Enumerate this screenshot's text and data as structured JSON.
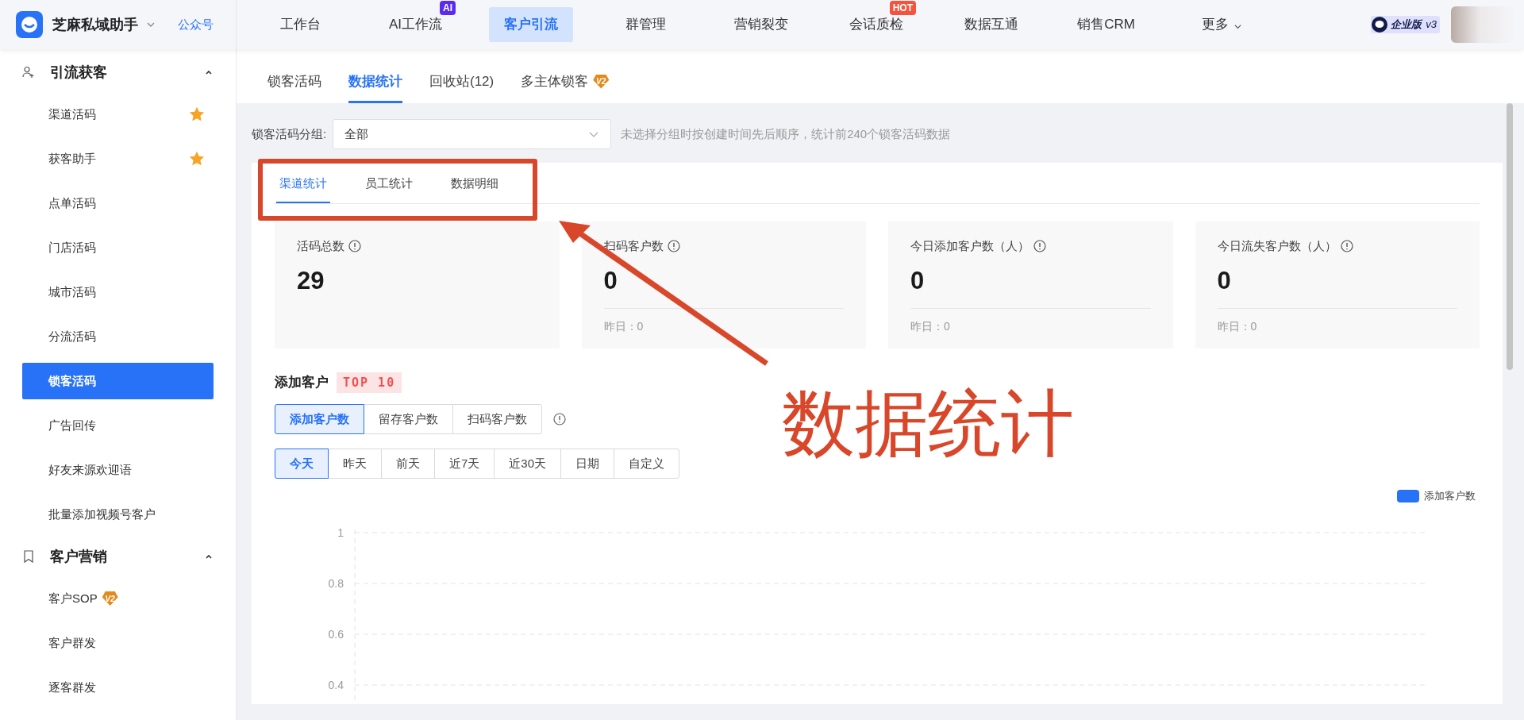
{
  "app": {
    "name": "芝麻私域助手",
    "link": "公众号"
  },
  "nav": [
    {
      "label": "工作台",
      "selected": false
    },
    {
      "label": "AI工作流",
      "selected": false,
      "badge": {
        "text": "AI",
        "color": "#5b2bf0"
      }
    },
    {
      "label": "客户引流",
      "selected": true
    },
    {
      "label": "群管理",
      "selected": false
    },
    {
      "label": "营销裂变",
      "selected": false
    },
    {
      "label": "会话质检",
      "selected": false,
      "badge": {
        "text": "HOT",
        "color": "#f5533d"
      }
    },
    {
      "label": "数据互通",
      "selected": false
    },
    {
      "label": "销售CRM",
      "selected": false
    },
    {
      "label": "更多",
      "selected": false,
      "dropdown": true
    }
  ],
  "account": {
    "edition": "企业版",
    "version": "v3"
  },
  "sidebar": {
    "sections": [
      {
        "title": "引流获客",
        "expanded": true,
        "items": [
          {
            "label": "渠道活码",
            "starred": true,
            "selected": false
          },
          {
            "label": "获客助手",
            "starred": true,
            "selected": false
          },
          {
            "label": "点单活码",
            "starred": false,
            "selected": false
          },
          {
            "label": "门店活码",
            "starred": false,
            "selected": false
          },
          {
            "label": "城市活码",
            "starred": false,
            "selected": false
          },
          {
            "label": "分流活码",
            "starred": false,
            "selected": false
          },
          {
            "label": "锁客活码",
            "starred": false,
            "selected": true
          },
          {
            "label": "广告回传",
            "starred": false,
            "selected": false
          },
          {
            "label": "好友来源欢迎语",
            "starred": false,
            "selected": false
          },
          {
            "label": "批量添加视频号客户",
            "starred": false,
            "selected": false
          }
        ]
      },
      {
        "title": "客户营销",
        "expanded": true,
        "items": [
          {
            "label": "客户SOP",
            "starred": false,
            "selected": false,
            "badge": "V2"
          },
          {
            "label": "客户群发",
            "starred": false,
            "selected": false
          },
          {
            "label": "逐客群发",
            "starred": false,
            "selected": false
          }
        ]
      }
    ]
  },
  "subtabs": [
    {
      "label": "锁客活码",
      "selected": false
    },
    {
      "label": "数据统计",
      "selected": true
    },
    {
      "label": "回收站(12)",
      "selected": false
    },
    {
      "label": "多主体锁客",
      "selected": false,
      "badge": "V2"
    }
  ],
  "filter": {
    "label": "锁客活码分组:",
    "value": "全部",
    "hint": "未选择分组时按创建时间先后顺序，统计前240个锁客活码数据"
  },
  "inner_tabs": [
    {
      "label": "渠道统计",
      "selected": true
    },
    {
      "label": "员工统计",
      "selected": false
    },
    {
      "label": "数据明细",
      "selected": false
    }
  ],
  "stats": [
    {
      "title": "活码总数",
      "value": "29"
    },
    {
      "title": "扫码客户数",
      "value": "0",
      "yesterday": "昨日：0"
    },
    {
      "title": "今日添加客户数（人）",
      "value": "0",
      "yesterday": "昨日：0"
    },
    {
      "title": "今日流失客户数（人）",
      "value": "0",
      "yesterday": "昨日：0"
    }
  ],
  "section": {
    "title": "添加客户",
    "tag": "TOP 10",
    "metrics": [
      {
        "label": "添加客户数",
        "selected": true
      },
      {
        "label": "留存客户数",
        "selected": false
      },
      {
        "label": "扫码客户数",
        "selected": false
      }
    ],
    "periods": [
      {
        "label": "今天",
        "selected": true
      },
      {
        "label": "昨天",
        "selected": false
      },
      {
        "label": "前天",
        "selected": false
      },
      {
        "label": "近7天",
        "selected": false
      },
      {
        "label": "近30天",
        "selected": false
      },
      {
        "label": "日期",
        "selected": false
      },
      {
        "label": "自定义",
        "selected": false
      }
    ],
    "chart_data": {
      "type": "bar",
      "grid": true,
      "ylim": [
        0,
        1
      ],
      "yticks": [
        0.4,
        0.6,
        0.8,
        1
      ],
      "series": [
        {
          "name": "添加客户数",
          "color": "#2772f7"
        }
      ]
    }
  },
  "annotation": {
    "text": "数据统计"
  }
}
